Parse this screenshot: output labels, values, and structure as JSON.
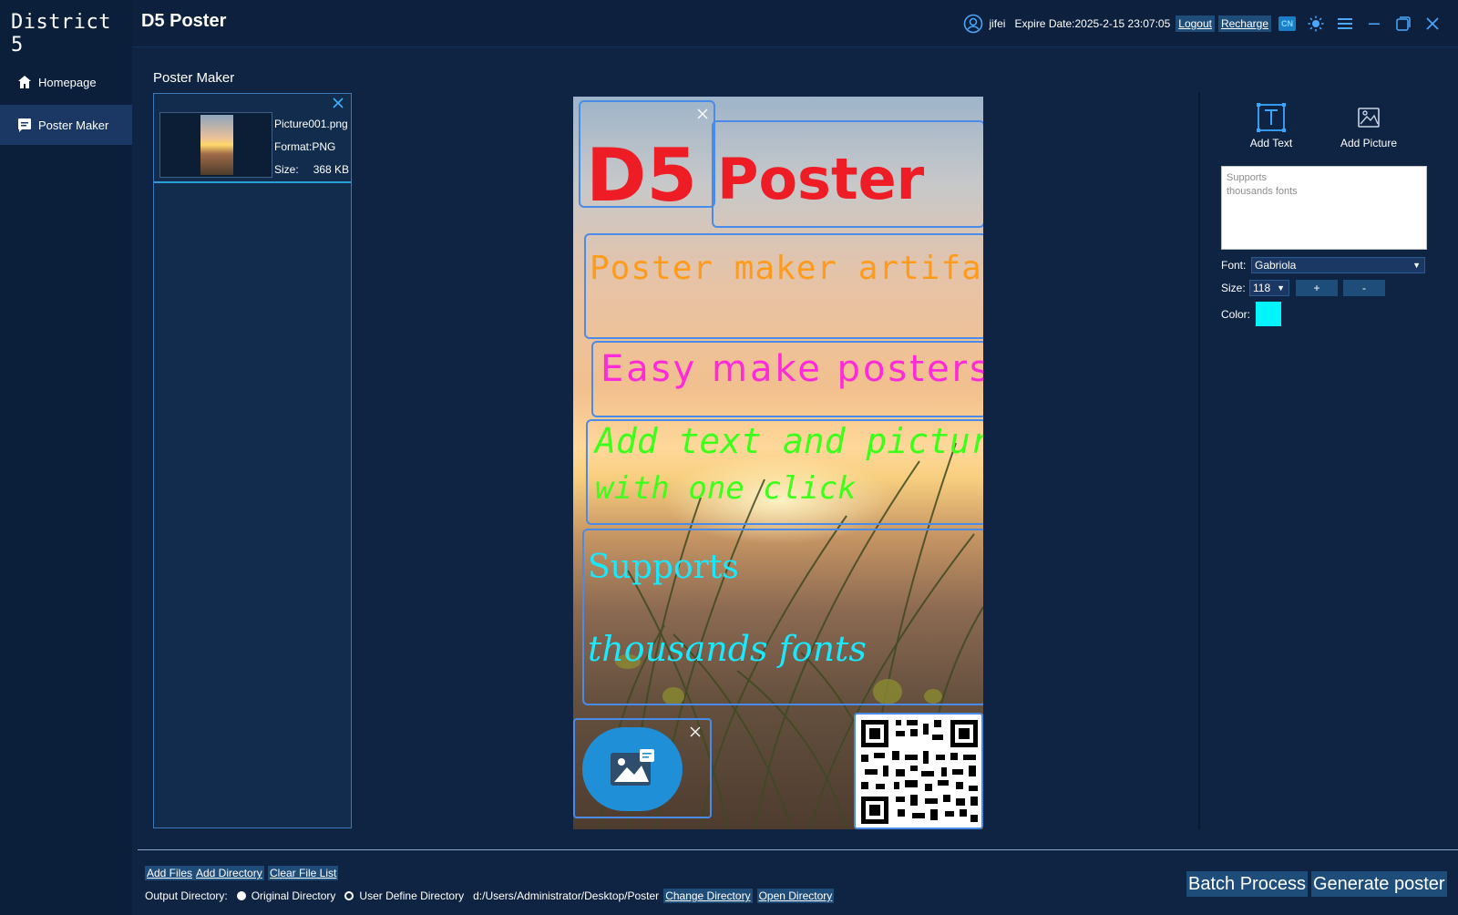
{
  "sidebar": {
    "brand": "District 5",
    "items": [
      {
        "label": "Homepage",
        "icon": "home-icon"
      },
      {
        "label": "Poster Maker",
        "icon": "poster-icon"
      }
    ]
  },
  "header": {
    "app_title": "D5 Poster",
    "username": "jifei",
    "expire": "Expire Date:2025-2-15 23:07:05",
    "logout": "Logout",
    "recharge": "Recharge",
    "lang_badge": "CN"
  },
  "main": {
    "title": "Poster Maker",
    "file": {
      "name": "Picture001.png",
      "format": "Format:PNG",
      "size_label": "Size:",
      "size_value": "368 KB"
    }
  },
  "canvas": {
    "texts": {
      "d5": "D5",
      "poster": "Poster",
      "maker": "Poster maker artifact",
      "easy": "Easy make posters",
      "add_line1": "Add text and pictures",
      "add_line2": "with one click",
      "supports": "Supports",
      "thousands": "thousands fonts"
    }
  },
  "tools": {
    "add_text": "Add Text",
    "add_picture": "Add Picture"
  },
  "properties": {
    "text_value": "Supports\nthousands fonts",
    "font_label": "Font:",
    "font_value": "Gabriola",
    "size_label": "Size:",
    "size_value": "118",
    "plus": "+",
    "minus": "-",
    "color_label": "Color:",
    "color_value": "#00f5ff"
  },
  "bottom": {
    "add_files": "Add Files",
    "add_directory": "Add Directory",
    "clear_list": "Clear File List",
    "output_label": "Output Directory:",
    "original_dir": "Original Directory",
    "user_dir": "User Define Directory",
    "path": "d:/Users/Administrator/Desktop/Poster",
    "change_dir": "Change Directory",
    "open_dir": "Open Directory",
    "batch": "Batch Process",
    "generate": "Generate poster"
  },
  "colors": {
    "accent": "#1f4d7a",
    "selection": "#4a8be8",
    "background": "#0f2442"
  }
}
